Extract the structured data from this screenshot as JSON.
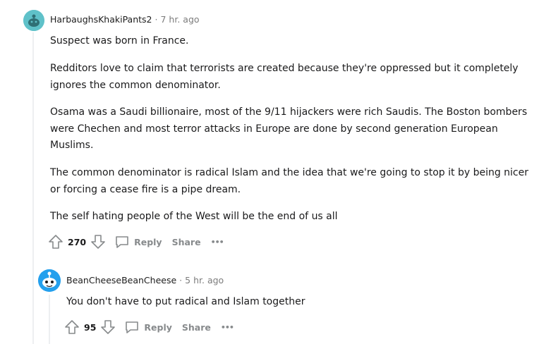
{
  "comments": [
    {
      "username": "HarbaughsKhakiPants2",
      "separator": "·",
      "time": "7 hr. ago",
      "paragraphs": [
        "Suspect was born in France.",
        "Redditors love to claim that terrorists are created because they're oppressed but it completely ignores the common denominator.",
        "Osama was a Saudi billionaire, most of the 9/11 hijackers were rich Saudis. The Boston bombers were Chechen and most terror attacks in Europe are done by second generation European Muslims.",
        "The common denominator is radical Islam and the idea that we're going to stop it by being nicer or forcing a cease fire is a pipe dream.",
        "The self hating people of the West will be the end of us all"
      ],
      "score": "270",
      "reply_label": "Reply",
      "share_label": "Share",
      "more_label": "•••",
      "avatar_color": "#5fc1c9"
    },
    {
      "username": "BeanCheeseBeanCheese",
      "separator": "·",
      "time": "5 hr. ago",
      "paragraphs": [
        "You don't have to put radical and Islam together"
      ],
      "score": "95",
      "reply_label": "Reply",
      "share_label": "Share",
      "more_label": "•••",
      "avatar_color": "#24a0ed"
    }
  ]
}
